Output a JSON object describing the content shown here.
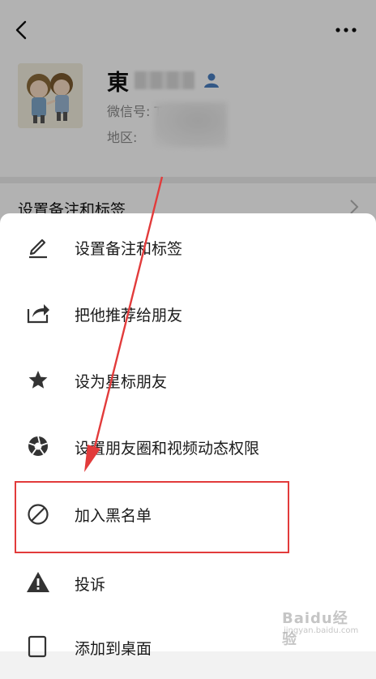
{
  "profile": {
    "name_visible": "東",
    "wechat_id_label": "微信号: T-",
    "region_label": "地区:",
    "remark_row_label": "设置备注和标签"
  },
  "menu": {
    "items": [
      {
        "label": "设置备注和标签",
        "icon": "edit-icon"
      },
      {
        "label": "把他推荐给朋友",
        "icon": "share-icon"
      },
      {
        "label": "设为星标朋友",
        "icon": "star-icon"
      },
      {
        "label": "设置朋友圈和视频动态权限",
        "icon": "aperture-icon"
      },
      {
        "label": "加入黑名单",
        "icon": "block-icon"
      },
      {
        "label": "投诉",
        "icon": "warning-icon"
      },
      {
        "label": "添加到桌面",
        "icon": "add-to-desktop-icon"
      }
    ]
  },
  "annotation": {
    "highlight_color": "#e23b3b",
    "highlighted_item": "加入黑名单"
  },
  "watermark": {
    "logo": "Baidu经验",
    "url": "jingyan.baidu.com"
  },
  "colors": {
    "sheet_bg": "#ffffff",
    "icon_color": "#333333",
    "mask": "rgba(0,0,0,0.30)"
  }
}
